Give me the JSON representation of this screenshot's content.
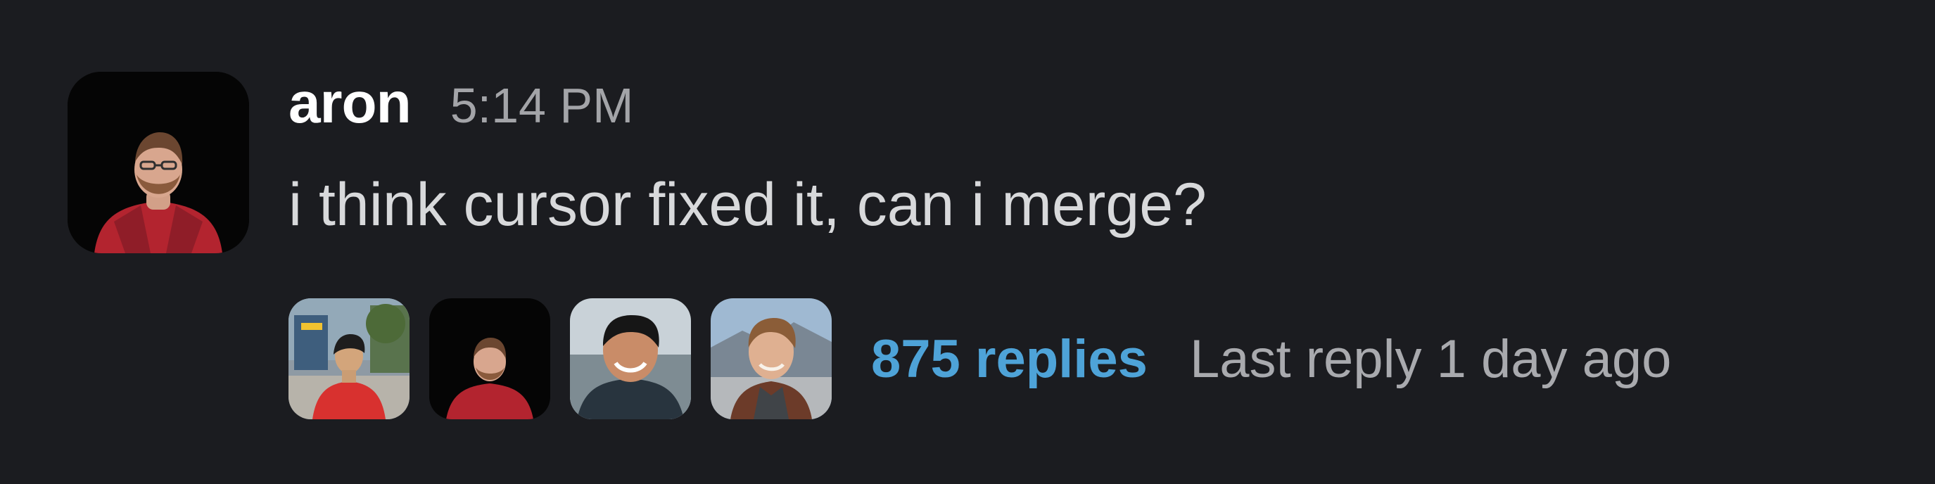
{
  "message": {
    "author": "aron",
    "timestamp": "5:14 PM",
    "text": "i think cursor fixed it, can i merge?"
  },
  "thread": {
    "participants": [
      {
        "name": "participant-1"
      },
      {
        "name": "participant-2"
      },
      {
        "name": "participant-3"
      },
      {
        "name": "participant-4"
      }
    ],
    "replies_label": "875 replies",
    "last_reply_label": "Last reply 1 day ago"
  },
  "colors": {
    "background": "#1b1c20",
    "author": "#ffffff",
    "timestamp": "#a3a4a8",
    "message_text": "#d8d9db",
    "replies_link": "#4ea3d8",
    "last_reply_text": "#a9aaae"
  }
}
